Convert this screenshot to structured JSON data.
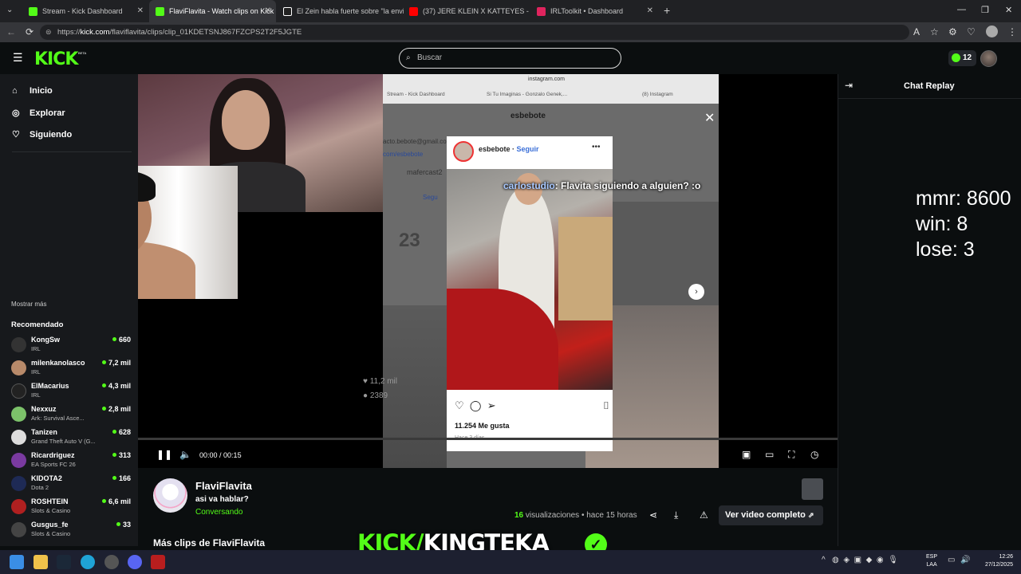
{
  "browser": {
    "tabs": [
      {
        "label": "Stream - Kick Dashboard",
        "active": false,
        "favicon_color": "#53fc18"
      },
      {
        "label": "FlaviFlavita - Watch clips on Kick",
        "active": true,
        "favicon_color": "#53fc18"
      },
      {
        "label": "El Zein habla fuerte sobre \"la envi",
        "active": false,
        "favicon_color": "#ffffff"
      },
      {
        "label": "(37) JERE KLEIN X KATTEYES - TOD",
        "active": false,
        "favicon_color": "#ff0000"
      },
      {
        "label": "IRLToolkit • Dashboard",
        "active": false,
        "favicon_color": "#e0245e"
      }
    ],
    "url_prefix": "https://",
    "url_host": "kick.com",
    "url_path": "/flaviflavita/clips/clip_01KDETSNJ867FZCPS2T2F5JGTE"
  },
  "header": {
    "logo": "KICK",
    "logo_badge": "BETA",
    "search_placeholder": "Buscar",
    "kicks_count": "12"
  },
  "sidebar": {
    "nav": [
      {
        "label": "Inicio",
        "icon": "home-icon"
      },
      {
        "label": "Explorar",
        "icon": "compass-icon"
      },
      {
        "label": "Siguiendo",
        "icon": "heart-icon"
      }
    ],
    "show_more": "Mostrar más",
    "recommended_title": "Recomendado",
    "recommended": [
      {
        "name": "KongSw",
        "category": "IRL",
        "viewers": "660",
        "avatar_color": "#333333"
      },
      {
        "name": "milenkanolasco",
        "category": "IRL",
        "viewers": "7,2 mil",
        "avatar_color": "#b88a6a"
      },
      {
        "name": "ElMacarius",
        "category": "IRL",
        "viewers": "4,3 mil",
        "avatar_color": "#222222"
      },
      {
        "name": "Nexxuz",
        "category": "Ark: Survival Asce...",
        "viewers": "2,8 mil",
        "avatar_color": "#7cc26a"
      },
      {
        "name": "Tanizen",
        "category": "Grand Theft Auto V (G...",
        "viewers": "628",
        "avatar_color": "#dddddd"
      },
      {
        "name": "Ricardriguez",
        "category": "EA Sports FC 26",
        "viewers": "313",
        "avatar_color": "#7a3aa0"
      },
      {
        "name": "KIDOTA2",
        "category": "Dota 2",
        "viewers": "166",
        "avatar_color": "#1e2a55"
      },
      {
        "name": "ROSHTEIN",
        "category": "Slots & Casino",
        "viewers": "6,6 mil",
        "avatar_color": "#b02020"
      },
      {
        "name": "Gusgus_fe",
        "category": "Slots & Casino",
        "viewers": "33",
        "avatar_color": "#444444"
      }
    ]
  },
  "player": {
    "ig_url": "instagram.com",
    "ig_tabs": [
      "Stream - Kick Dashboard",
      "Si Tu Imaginas - Gonzalo Genek,...",
      "(8) Instagram"
    ],
    "ig_profile_name": "esbebote",
    "ig_contact": "acto.bebote@gmail.co",
    "ig_link": "com/esbebote",
    "ig_other_user": "mafercast2",
    "ig_follow": "Segu",
    "ig_stat": "23",
    "ig_bg_likes": "11,2 mil",
    "ig_bg_comments": "2389",
    "post_user": "esbebote",
    "post_follow": "Seguir",
    "post_likes": "11.254 Me gusta",
    "post_date": "Hace 3 días",
    "chat_user": "carlostudio",
    "chat_text": ": Flavita siguiendo a alguien? :o",
    "time_current": "00:00",
    "time_total": "00:15",
    "progress": 0.0
  },
  "overlay": {
    "mmr": "mmr: 8600",
    "win": "win: 8",
    "lose": "lose: 3"
  },
  "chat": {
    "title": "Chat Replay"
  },
  "clip": {
    "owner": "FlaviFlavita",
    "title": "asi va hablar?",
    "category": "Conversando",
    "views": "16",
    "views_label": "visualizaciones",
    "time_ago": "hace 15 horas",
    "full_video_label": "Ver video completo",
    "more_clips": "Más clips de FlaviFlavita"
  },
  "brand_overlay": {
    "prefix": "KICK/",
    "name": "KINGTEKA"
  },
  "taskbar": {
    "lang_line1": "ESP",
    "lang_line2": "LAA",
    "time": "12:26",
    "date": "27/12/2025"
  }
}
